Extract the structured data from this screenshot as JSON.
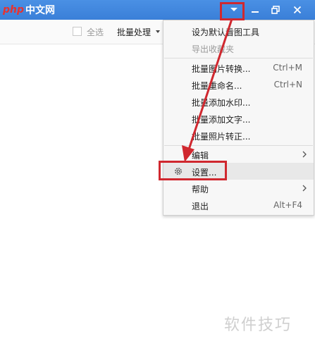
{
  "app": {
    "logo_php": "php",
    "logo_cn": "中文网"
  },
  "toolbar": {
    "select_all_label": "全选",
    "batch_label": "批量处理"
  },
  "menu": {
    "items": [
      {
        "label": "设为默认看图工具"
      },
      {
        "label": "导出收藏夹"
      },
      {
        "label": "批量图片转换...",
        "shortcut": "Ctrl+M"
      },
      {
        "label": "批量重命名...",
        "shortcut": "Ctrl+N"
      },
      {
        "label": "批量添加水印..."
      },
      {
        "label": "批量添加文字..."
      },
      {
        "label": "批量照片转正..."
      },
      {
        "label": "编辑"
      },
      {
        "label": "设置..."
      },
      {
        "label": "帮助"
      },
      {
        "label": "退出",
        "shortcut": "Alt+F4"
      }
    ]
  },
  "colors": {
    "titlebar": "#3a7fd8",
    "highlight": "#d0282f",
    "logo_php": "#e8312e"
  },
  "icons": {
    "titlebar_buttons": [
      "dropdown-arrow-icon",
      "minimize-icon",
      "restore-icon",
      "close-icon"
    ],
    "menu": [
      "gear-icon",
      "chevron-right-icon"
    ]
  },
  "watermark": "软件技巧"
}
